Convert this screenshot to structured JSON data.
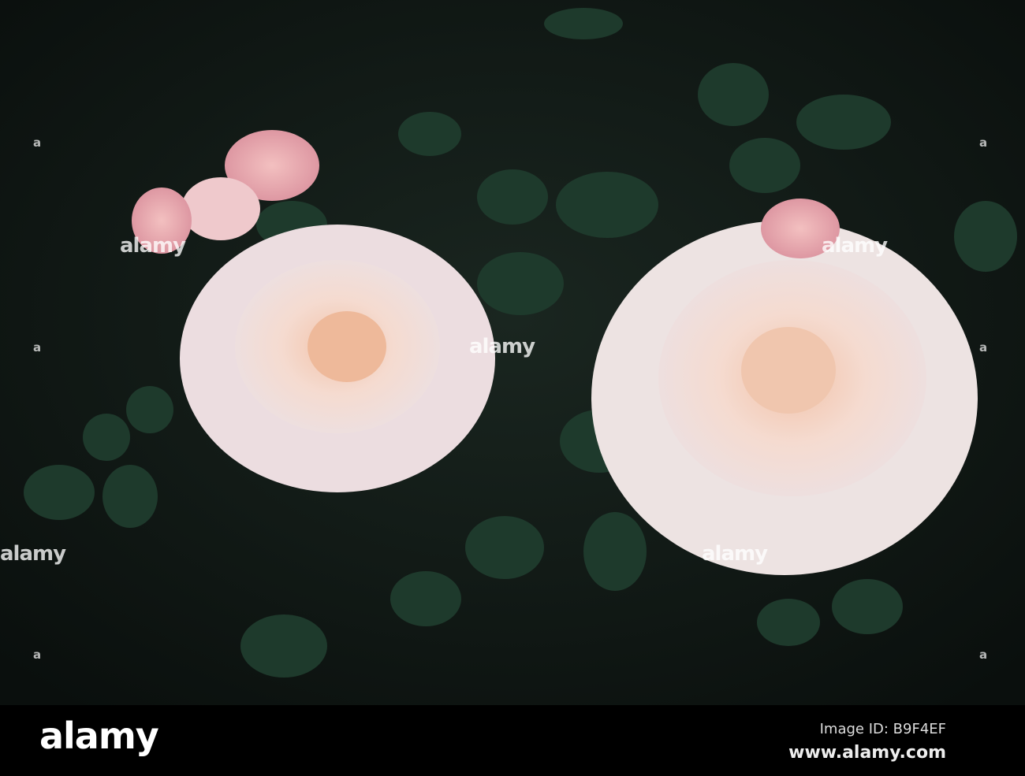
{
  "photo": {
    "subject": "pink-white roses with dark green leaves"
  },
  "watermark": {
    "text": "alamy",
    "small": "a"
  },
  "footer": {
    "logo": "alamy",
    "image_id": "Image ID: B9F4EF",
    "url": "www.alamy.com"
  },
  "colors": {
    "background": "#0f1714",
    "leaf": "#1f3a2c",
    "petal": "#f3dcd4",
    "petal_center": "#f0c8b4",
    "bud": "#e7a8b0"
  }
}
